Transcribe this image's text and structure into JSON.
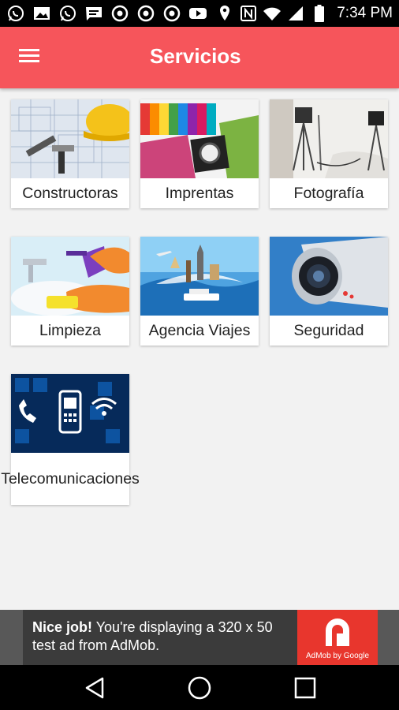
{
  "status_bar": {
    "time": "7:34 PM",
    "left_icons": [
      "whatsapp-icon",
      "image-icon",
      "whatsapp-icon",
      "message-icon",
      "chrome-icon",
      "chrome-icon",
      "chrome-icon",
      "youtube-icon"
    ],
    "right_icons": [
      "location-icon",
      "nfc-icon",
      "wifi-icon",
      "signal-icon",
      "battery-icon"
    ]
  },
  "app_bar": {
    "title": "Servicios",
    "menu_icon": "hamburger-menu-icon",
    "color": "#f6555b"
  },
  "services": [
    {
      "label": "Constructoras",
      "image": "construction-image"
    },
    {
      "label": "Imprentas",
      "image": "printing-image"
    },
    {
      "label": "Fotografía",
      "image": "photo-studio-image"
    },
    {
      "label": "Limpieza",
      "image": "cleaning-image"
    },
    {
      "label": "Agencia Viajes",
      "image": "travel-image"
    },
    {
      "label": "Seguridad",
      "image": "security-camera-image"
    },
    {
      "label": "Telecomunicaciones",
      "label_lines": [
        "Telecomunica",
        "ciones"
      ],
      "image": "telecom-image"
    }
  ],
  "ad": {
    "headline": "Nice job!",
    "body": " You're displaying a 320 x 50 test ad from AdMob.",
    "brand": "AdMob by Google",
    "logo_color": "#e8362d"
  },
  "nav_bar": {
    "buttons": [
      "back-icon",
      "home-icon",
      "recents-icon"
    ]
  }
}
